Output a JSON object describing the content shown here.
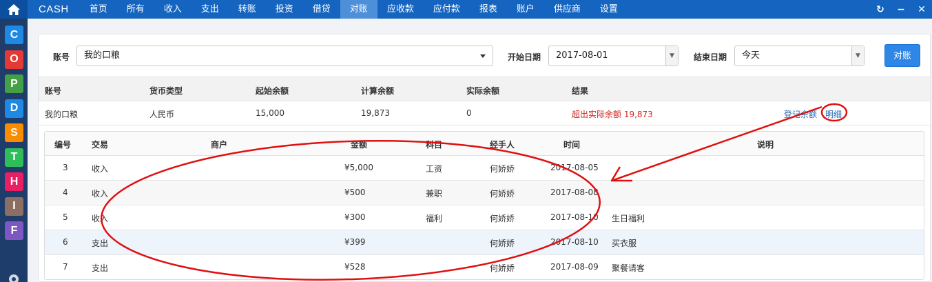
{
  "app": {
    "brand": "CASH"
  },
  "nav": [
    {
      "label": "首页"
    },
    {
      "label": "所有"
    },
    {
      "label": "收入"
    },
    {
      "label": "支出"
    },
    {
      "label": "转账"
    },
    {
      "label": "投资"
    },
    {
      "label": "借贷"
    },
    {
      "label": "对账"
    },
    {
      "label": "应收款"
    },
    {
      "label": "应付款"
    },
    {
      "label": "报表"
    },
    {
      "label": "账户"
    },
    {
      "label": "供应商"
    },
    {
      "label": "设置"
    }
  ],
  "nav_active": "对账",
  "top_icons": {
    "refresh": "↻",
    "minimize": "−",
    "close": "✕"
  },
  "sidebar": [
    {
      "letter": "C",
      "color": "#1e88e5"
    },
    {
      "letter": "O",
      "color": "#e53935"
    },
    {
      "letter": "P",
      "color": "#43a047"
    },
    {
      "letter": "D",
      "color": "#1e88e5"
    },
    {
      "letter": "S",
      "color": "#fb8c00"
    },
    {
      "letter": "T",
      "color": "#2ebd59"
    },
    {
      "letter": "H",
      "color": "#e91e63"
    },
    {
      "letter": "I",
      "color": "#8d6e63"
    },
    {
      "letter": "F",
      "color": "#7e57c2"
    }
  ],
  "filter": {
    "account_label": "账号",
    "account_value": "我的口粮",
    "start_label": "开始日期",
    "start_value": "2017-08-01",
    "end_label": "结束日期",
    "end_value": "今天",
    "reconcile_button": "对账"
  },
  "summary": {
    "headers": [
      "账号",
      "货币类型",
      "起始余额",
      "计算余额",
      "实际余额",
      "结果"
    ],
    "row": {
      "account": "我的口粮",
      "currency": "人民币",
      "start_balance": "15,000",
      "calc_balance": "19,873",
      "actual_balance": "0",
      "result": "超出实际余额 19,873"
    },
    "actions": {
      "register": "登记余额",
      "detail": "明细"
    }
  },
  "detail": {
    "headers": [
      "编号",
      "交易",
      "商户",
      "金额",
      "科目",
      "经手人",
      "时间",
      "说明"
    ],
    "rows": [
      {
        "id": "3",
        "type": "收入",
        "merchant": "",
        "amount": "¥5,000",
        "category": "工资",
        "handler": "何娇娇",
        "date": "2017-08-05",
        "note": ""
      },
      {
        "id": "4",
        "type": "收入",
        "merchant": "",
        "amount": "¥500",
        "category": "兼职",
        "handler": "何娇娇",
        "date": "2017-08-08",
        "note": ""
      },
      {
        "id": "5",
        "type": "收入",
        "merchant": "",
        "amount": "¥300",
        "category": "福利",
        "handler": "何娇娇",
        "date": "2017-08-10",
        "note": "生日福利"
      },
      {
        "id": "6",
        "type": "支出",
        "merchant": "",
        "amount": "¥399",
        "category": "",
        "handler": "何娇娇",
        "date": "2017-08-10",
        "note": "买衣服"
      },
      {
        "id": "7",
        "type": "支出",
        "merchant": "",
        "amount": "¥528",
        "category": "",
        "handler": "何娇娇",
        "date": "2017-08-09",
        "note": "聚餐请客"
      }
    ]
  },
  "annotation_color": "#e01010"
}
